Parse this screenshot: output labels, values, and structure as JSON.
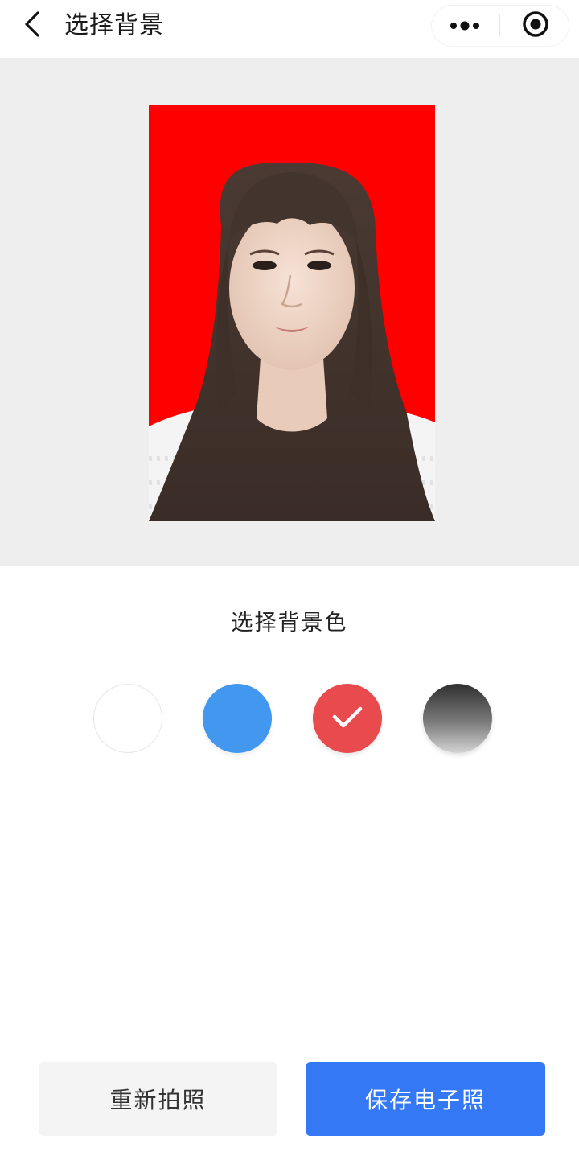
{
  "navbar": {
    "title": "选择背景",
    "back_icon": "chevron-left-icon",
    "more_icon": "more-dots-icon",
    "close_icon": "target-circle-icon"
  },
  "photo": {
    "background_color": "#ff0000"
  },
  "selector": {
    "title": "选择背景色",
    "options": [
      {
        "name": "white",
        "color": "#ffffff",
        "selected": false
      },
      {
        "name": "blue",
        "color": "#4198ee",
        "selected": false
      },
      {
        "name": "red",
        "color": "#e84a4e",
        "selected": true
      },
      {
        "name": "gradient-gray",
        "color": "#3a3a3a",
        "selected": false
      }
    ]
  },
  "actions": {
    "retake_label": "重新拍照",
    "save_label": "保存电子照"
  },
  "colors": {
    "primary": "#3478f6",
    "preview_bg": "#eeeeef"
  }
}
